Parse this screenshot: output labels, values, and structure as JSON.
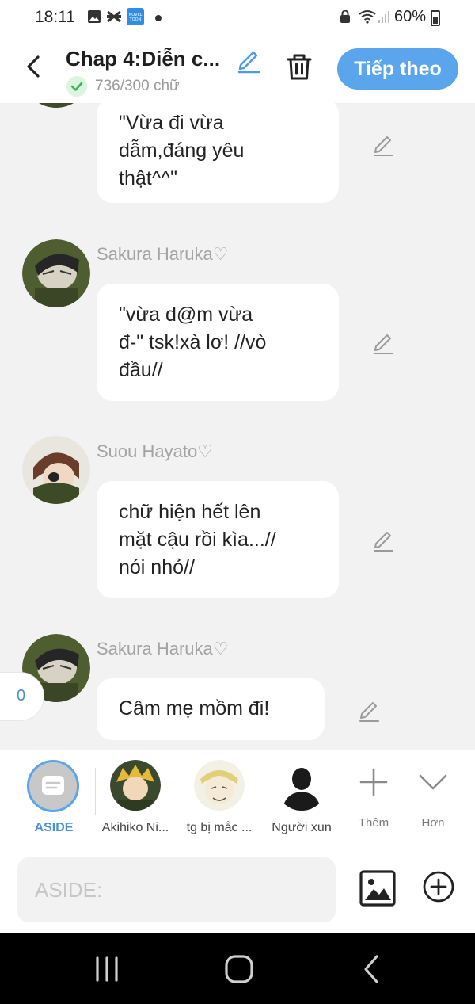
{
  "status_bar": {
    "time": "18:11",
    "battery": "60%",
    "icons": [
      "gallery-icon",
      "capcut-icon",
      "novel-toon-icon",
      "notification-dot",
      "lock-icon",
      "wifi-icon",
      "signal-icon",
      "battery-icon"
    ]
  },
  "header": {
    "title": "Chap 4:Diễn c...",
    "word_count": "736/300 chữ",
    "next_label": "Tiếp theo",
    "accent_color": "#5aa5ec"
  },
  "messages": [
    {
      "sender": "",
      "lines": [
        "\"Vừa đi vừa",
        "dẫm,đáng yêu",
        "thật^^\""
      ]
    },
    {
      "sender": "Sakura Haruka♡",
      "lines": [
        "\"vừa d@m vừa",
        "đ-\" tsk!xà lơ! //vò",
        "đầu//"
      ]
    },
    {
      "sender": "Suou Hayato♡",
      "lines": [
        "chữ hiện hết lên",
        "mặt cậu rồi kìa...//",
        "nói nhỏ//"
      ]
    },
    {
      "sender": "Sakura Haruka♡",
      "lines": [
        "Câm mẹ mồm đi!"
      ]
    }
  ],
  "floating_count": "0",
  "characters": {
    "aside_label": "ASIDE",
    "items": [
      {
        "label": "Akihiko Ni..."
      },
      {
        "label": "tg bị mắc ..."
      },
      {
        "label": "Người xun"
      }
    ],
    "more_label": "Thêm",
    "expand_label": "Hơn"
  },
  "input": {
    "placeholder": "ASIDE:"
  }
}
